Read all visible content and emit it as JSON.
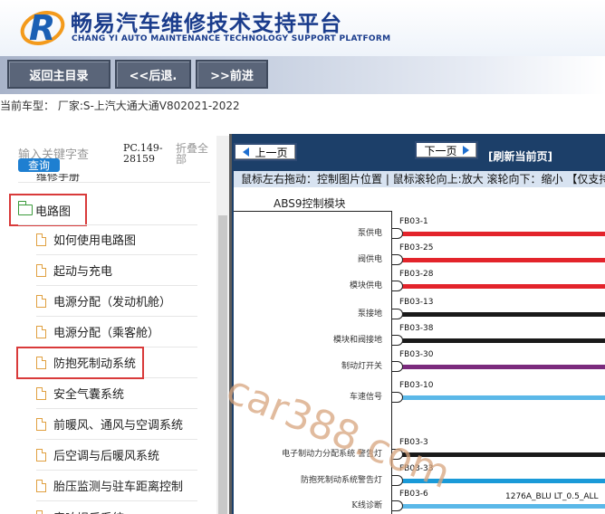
{
  "header": {
    "title_cn": "畅易汽车维修技术支持平台",
    "title_en": "CHANG YI AUTO MAINTENANCE TECHNOLOGY SUPPORT PLATFORM",
    "logo_icon": "r-logo-icon"
  },
  "nav": {
    "home_label": "返回主目录",
    "back_label": "<<后退.",
    "forward_label": ">>前进"
  },
  "model_line": "当前车型： 厂家:S-上汽大通大通V802021-2022",
  "sidebar": {
    "search_placeholder": "输入关键字查",
    "search_button": "查询",
    "pc_code": "PC.149-28159",
    "collapse_all": "折叠全部",
    "prev_row_label": "维修手册",
    "root_folder": "电路图",
    "items": [
      {
        "label": "如何使用电路图"
      },
      {
        "label": "起动与充电"
      },
      {
        "label": "电源分配（发动机舱）"
      },
      {
        "label": "电源分配（乘客舱）"
      },
      {
        "label": "防抱死制动系统"
      },
      {
        "label": "安全气囊系统"
      },
      {
        "label": "前暖风、通风与空调系统"
      },
      {
        "label": "后空调与后暖风系统"
      },
      {
        "label": "胎压监测与驻车距离控制"
      },
      {
        "label": "音响娱乐系统"
      }
    ],
    "selected_index": 4
  },
  "viewer": {
    "prev_page": "上一页",
    "next_page": "下一页",
    "refresh": "[刷新当前页]",
    "hint": "鼠标左右拖动：控制图片位置 | 鼠标滚轮向上:放大  滚轮向下：缩小 【仅支持IE浏览器】",
    "module_title": "ABS9控制模块",
    "watermark": "car388.com",
    "wire_tag": "1276A_BLU LT_0.5_ALL",
    "pins": [
      {
        "code": "FB03-1",
        "label": "泵供电",
        "color": "#e3242b"
      },
      {
        "code": "FB03-25",
        "label": "阀供电",
        "color": "#e3242b"
      },
      {
        "code": "FB03-28",
        "label": "模块供电",
        "color": "#e3242b"
      },
      {
        "code": "FB03-13",
        "label": "泵接地",
        "color": "#1a1a1a"
      },
      {
        "code": "FB03-38",
        "label": "模块和阀接地",
        "color": "#1a1a1a"
      },
      {
        "code": "FB03-30",
        "label": "制动灯开关",
        "color": "#7b2b7d"
      },
      {
        "code": "FB03-10",
        "label": "车速信号",
        "color": "#5bb8e8"
      },
      {
        "code": "FB03-3",
        "label": "电子制动力分配系统 警告灯",
        "color": "#1a1a1a"
      },
      {
        "code": "FB03-33",
        "label": "防抱死制动系统警告灯",
        "color": "#1a9ad8"
      },
      {
        "code": "FB03-6",
        "label": "K线诊断",
        "color": "#5bb8e8"
      }
    ]
  }
}
